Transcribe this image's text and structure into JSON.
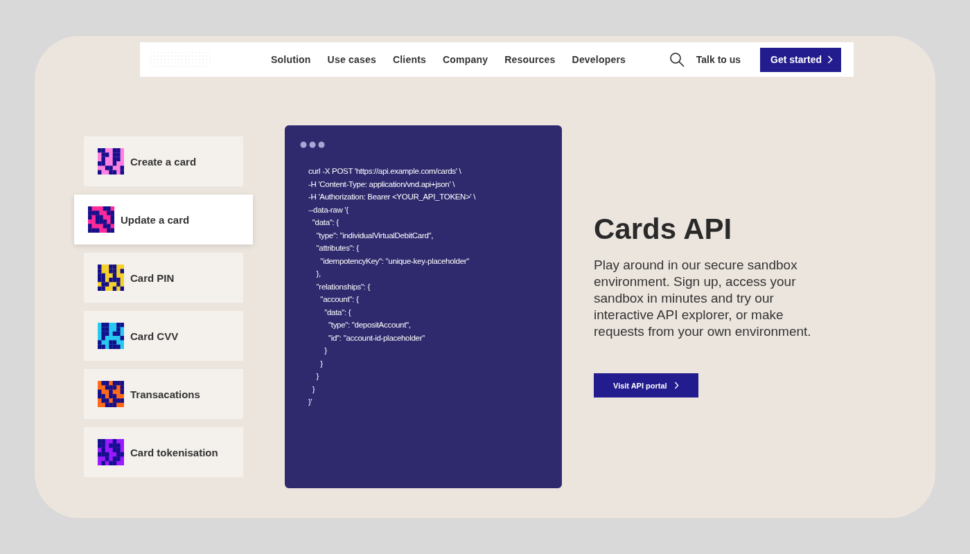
{
  "nav": {
    "links": [
      "Solution",
      "Use cases",
      "Clients",
      "Company",
      "Resources",
      "Developers"
    ],
    "talk": "Talk to us",
    "cta": "Get started"
  },
  "menu": [
    {
      "label": "Create a card",
      "selected": false,
      "color": "#ff80e0"
    },
    {
      "label": "Update a card",
      "selected": true,
      "color": "#ff2a9a"
    },
    {
      "label": "Card PIN",
      "selected": false,
      "color": "#f5d22a"
    },
    {
      "label": "Card CVV",
      "selected": false,
      "color": "#28c8f0"
    },
    {
      "label": "Transacations",
      "selected": false,
      "color": "#ff6a1a"
    },
    {
      "label": "Card tokenisation",
      "selected": false,
      "color": "#9a1aff"
    }
  ],
  "code": [
    "curl -X POST 'https://api.example.com/cards' \\",
    "-H 'Content-Type: application/vnd.api+json' \\",
    "-H 'Authorization: Bearer <YOUR_API_TOKEN>' \\",
    "--data-raw '{",
    "  \"data\": {",
    "    \"type\": \"individualVirtualDebitCard\",",
    "    \"attributes\": {",
    "      \"idempotencyKey\": \"unique-key-placeholder\"",
    "    },",
    "    \"relationships\": {",
    "      \"account\": {",
    "        \"data\": {",
    "          \"type\": \"depositAccount\",",
    "          \"id\": \"account-id-placeholder\"",
    "        }",
    "      }",
    "    }",
    "  }",
    "}'"
  ],
  "hero": {
    "title": "Cards API",
    "text": "Play around in our secure sandbox environment. Sign up, access your sandbox in minutes and try our interactive API explorer, or make requests from your own environment.",
    "button": "Visit API portal"
  }
}
